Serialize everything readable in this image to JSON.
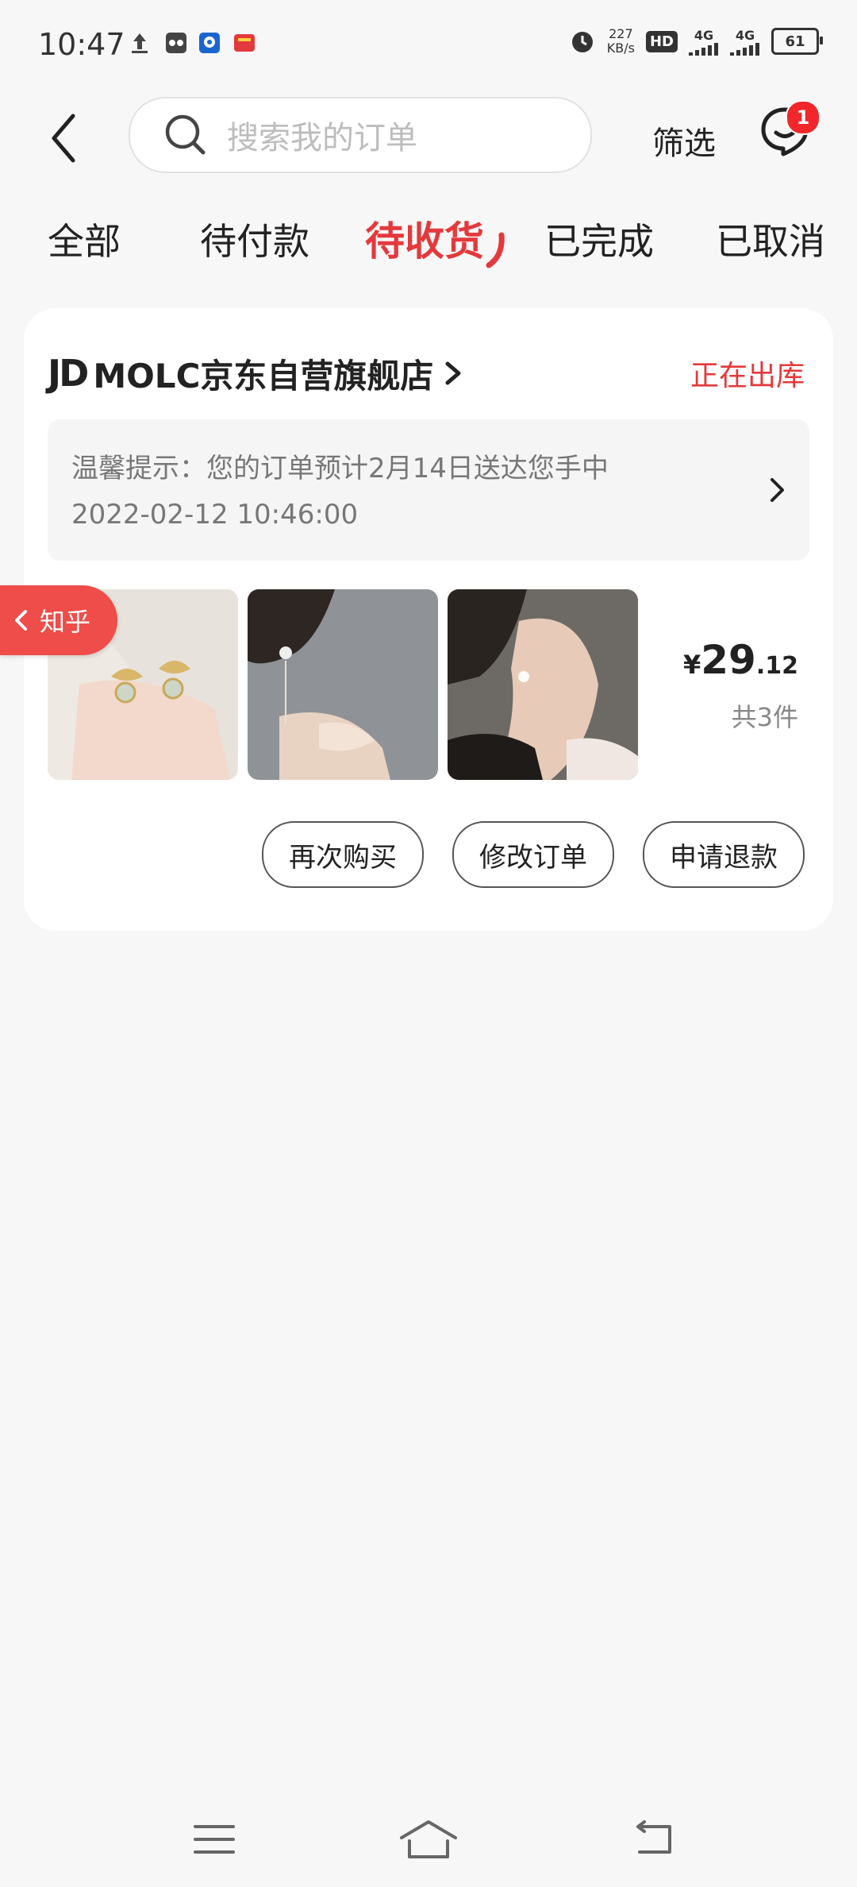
{
  "status_bar": {
    "time": "10:47",
    "network_speed": "227",
    "network_unit": "KB/s",
    "hd_label": "HD",
    "signal1": "4G",
    "signal2": "4G",
    "battery": "61"
  },
  "search": {
    "placeholder": "搜索我的订单"
  },
  "header": {
    "filter_label": "筛选",
    "message_badge": "1"
  },
  "tabs": [
    {
      "label": "全部"
    },
    {
      "label": "待付款"
    },
    {
      "label": "待收货"
    },
    {
      "label": "已完成"
    },
    {
      "label": "已取消"
    }
  ],
  "active_tab": "待收货",
  "order": {
    "shop_logo": "JD",
    "shop_name": "MOLC京东自营旗舰店",
    "status": "正在出库",
    "tip_text": "温馨提示：您的订单预计2月14日送达您手中",
    "tip_time": "2022-02-12 10:46:00",
    "price_symbol": "¥",
    "price_int": "29",
    "price_dec": ".12",
    "quantity": "共3件",
    "buttons": {
      "rebuy": "再次购买",
      "modify": "修改订单",
      "refund": "申请退款"
    }
  },
  "floating_tab": {
    "label": "知乎"
  },
  "colors": {
    "accent": "#e4393c",
    "badge": "#f1272b",
    "zhihu": "#ee4d4a"
  }
}
